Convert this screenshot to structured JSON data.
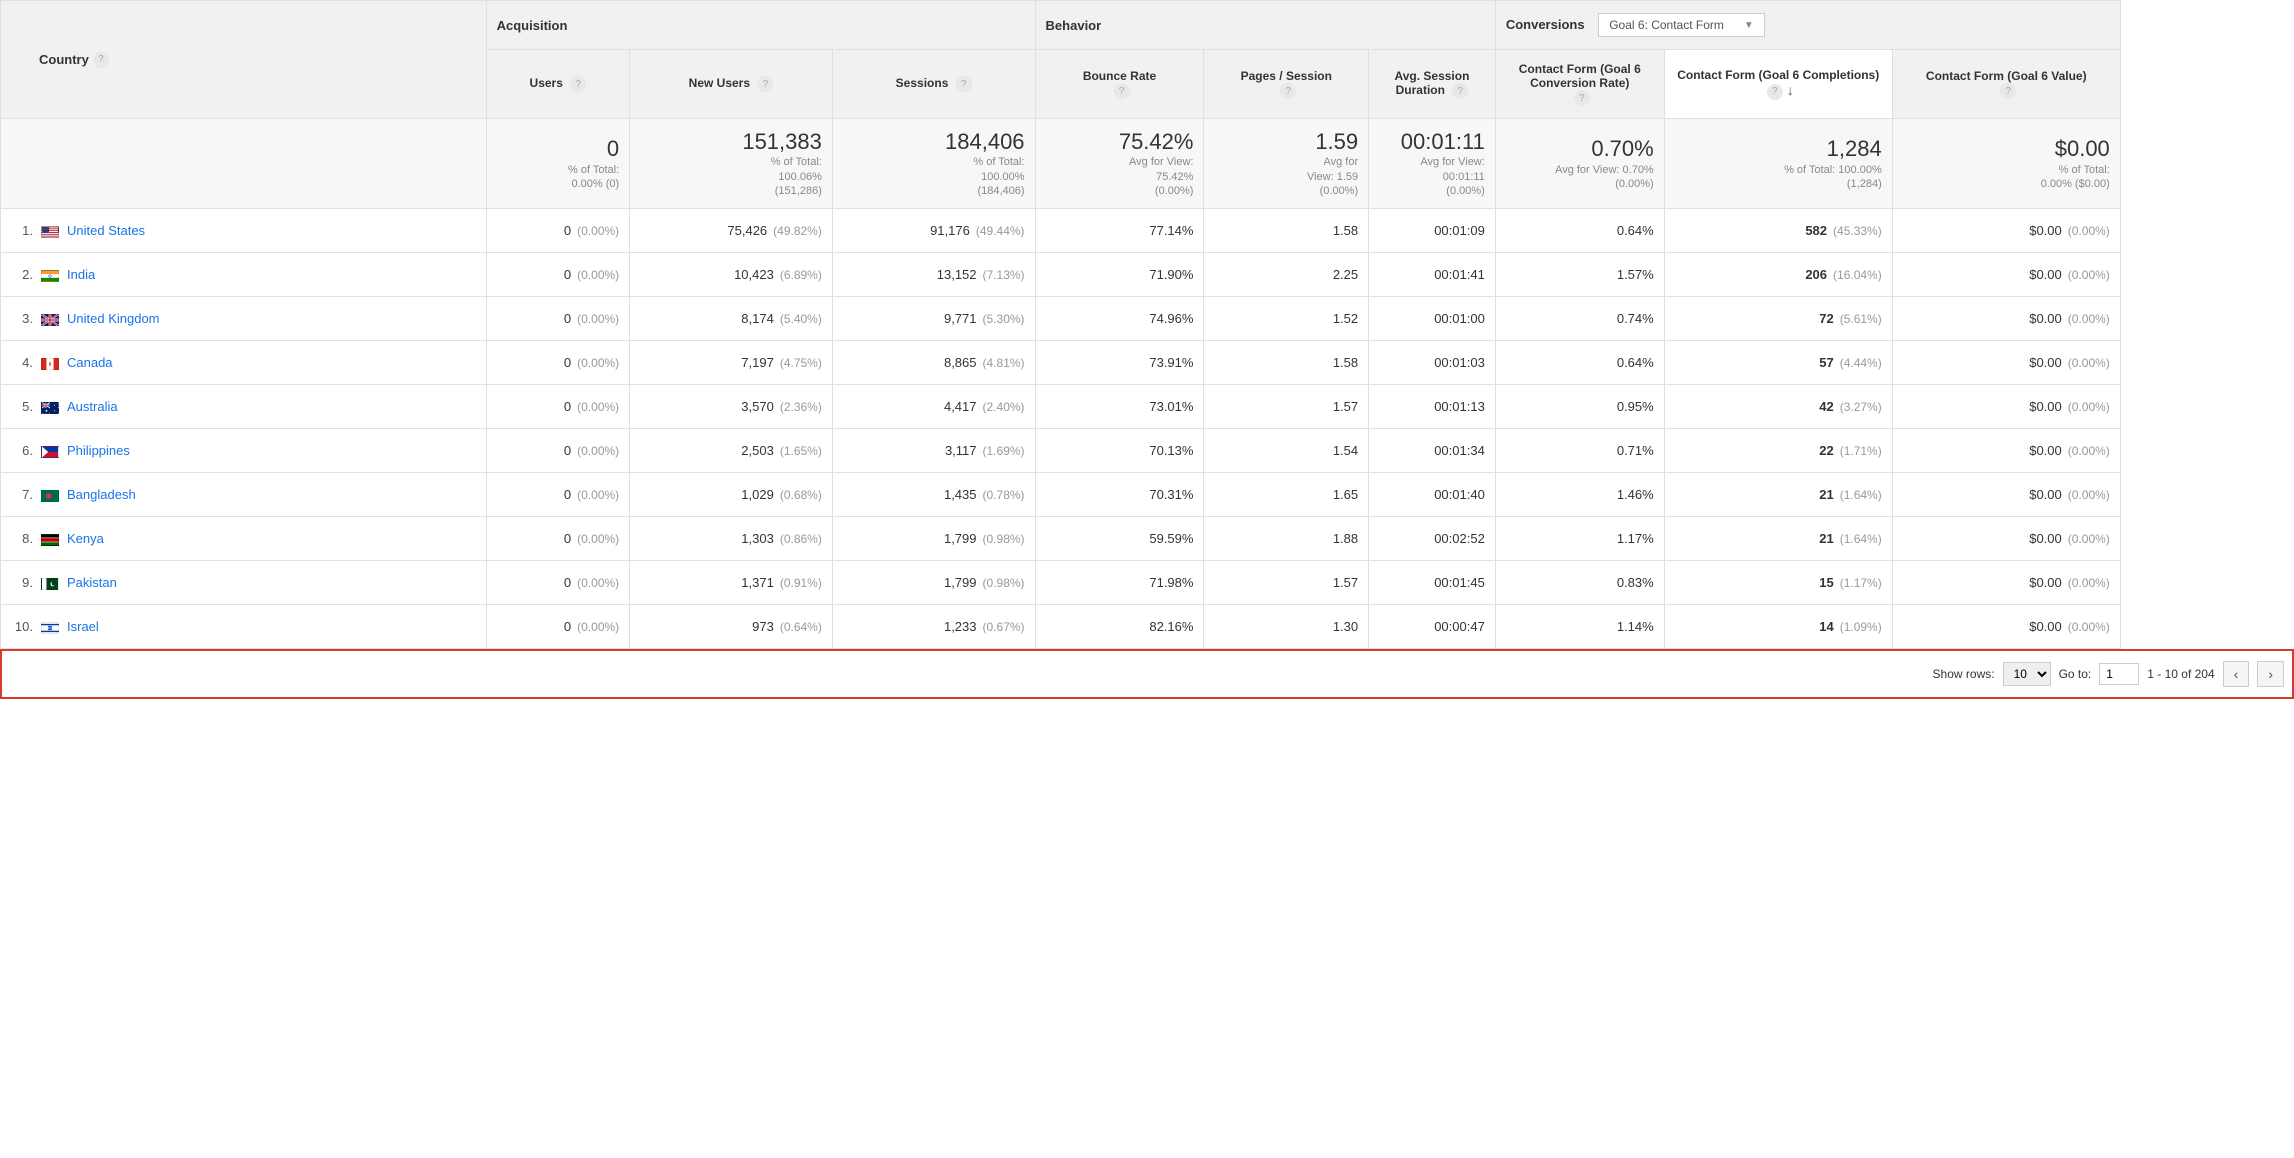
{
  "dimension_label": "Country",
  "groups": {
    "acquisition": "Acquisition",
    "behavior": "Behavior",
    "conversions": "Conversions"
  },
  "goal_selector": "Goal 6: Contact Form",
  "columns": {
    "users": "Users",
    "new_users": "New Users",
    "sessions": "Sessions",
    "bounce_rate": "Bounce Rate",
    "pages_session": "Pages / Session",
    "avg_duration": "Avg. Session Duration",
    "conv_rate": "Contact Form (Goal 6 Conversion Rate)",
    "completions": "Contact Form (Goal 6 Completions)",
    "value": "Contact Form (Goal 6 Value)"
  },
  "summary": {
    "users": {
      "big": "0",
      "sub1": "% of Total:",
      "sub2": "0.00% (0)"
    },
    "new_users": {
      "big": "151,383",
      "sub1": "% of Total:",
      "sub2": "100.06%",
      "sub3": "(151,286)"
    },
    "sessions": {
      "big": "184,406",
      "sub1": "% of Total:",
      "sub2": "100.00%",
      "sub3": "(184,406)"
    },
    "bounce_rate": {
      "big": "75.42%",
      "sub1": "Avg for View:",
      "sub2": "75.42%",
      "sub3": "(0.00%)"
    },
    "pages_session": {
      "big": "1.59",
      "sub1": "Avg for",
      "sub2": "View: 1.59",
      "sub3": "(0.00%)"
    },
    "avg_duration": {
      "big": "00:01:11",
      "sub1": "Avg for View:",
      "sub2": "00:01:11",
      "sub3": "(0.00%)"
    },
    "conv_rate": {
      "big": "0.70%",
      "sub1": "Avg for View: 0.70%",
      "sub2": "(0.00%)"
    },
    "completions": {
      "big": "1,284",
      "sub1": "% of Total: 100.00%",
      "sub2": "(1,284)"
    },
    "value": {
      "big": "$0.00",
      "sub1": "% of Total:",
      "sub2": "0.00% ($0.00)"
    }
  },
  "flags": {
    "United States": "data:image/svg+xml;utf8,<svg xmlns='http://www.w3.org/2000/svg' width='18' height='12'><rect width='18' height='12' fill='%23b22234'/><rect y='1' width='18' height='1' fill='white'/><rect y='3' width='18' height='1' fill='white'/><rect y='5' width='18' height='1' fill='white'/><rect y='7' width='18' height='1' fill='white'/><rect y='9' width='18' height='1' fill='white'/><rect y='11' width='18' height='1' fill='white'/><rect width='8' height='7' fill='%233c3b6e'/></svg>",
    "India": "data:image/svg+xml;utf8,<svg xmlns='http://www.w3.org/2000/svg' width='18' height='12'><rect width='18' height='4' fill='%23ff9933'/><rect y='4' width='18' height='4' fill='white'/><rect y='8' width='18' height='4' fill='%23138808'/><circle cx='9' cy='6' r='1.4' fill='none' stroke='%23000088' stroke-width='0.5'/></svg>",
    "United Kingdom": "data:image/svg+xml;utf8,<svg xmlns='http://www.w3.org/2000/svg' width='18' height='12'><rect width='18' height='12' fill='%23012169'/><path d='M0,0 L18,12 M18,0 L0,12' stroke='white' stroke-width='2'/><path d='M0,0 L18,12 M18,0 L0,12' stroke='%23C8102E' stroke-width='1'/><path d='M9,0 V12 M0,6 H18' stroke='white' stroke-width='3'/><path d='M9,0 V12 M0,6 H18' stroke='%23C8102E' stroke-width='1.5'/></svg>",
    "Canada": "data:image/svg+xml;utf8,<svg xmlns='http://www.w3.org/2000/svg' width='18' height='12'><rect width='18' height='12' fill='white'/><rect width='5' height='12' fill='%23d52b1e'/><rect x='13' width='5' height='12' fill='%23d52b1e'/><path d='M9 3 L10 6 L9 9 L8 6 Z' fill='%23d52b1e'/></svg>",
    "Australia": "data:image/svg+xml;utf8,<svg xmlns='http://www.w3.org/2000/svg' width='18' height='12'><rect width='18' height='12' fill='%23012169'/><rect width='9' height='6' fill='%23012169'/><path d='M0,0 L9,6 M9,0 L0,6' stroke='white' stroke-width='1'/><path d='M4.5,0 V6 M0,3 H9' stroke='white' stroke-width='1.5'/><path d='M4.5,0 V6 M0,3 H9' stroke='%23C8102E' stroke-width='0.8'/><circle cx='5' cy='9' r='1' fill='white'/><circle cx='14' cy='3' r='0.6' fill='white'/><circle cx='14' cy='9' r='0.6' fill='white'/></svg>",
    "Philippines": "data:image/svg+xml;utf8,<svg xmlns='http://www.w3.org/2000/svg' width='18' height='12'><rect width='18' height='6' fill='%230038a8'/><rect y='6' width='18' height='6' fill='%23ce1126'/><path d='M0,0 L7,6 L0,12 Z' fill='white'/></svg>",
    "Bangladesh": "data:image/svg+xml;utf8,<svg xmlns='http://www.w3.org/2000/svg' width='18' height='12'><rect width='18' height='12' fill='%23006a4e'/><circle cx='7.5' cy='6' r='3' fill='%23f42a41'/></svg>",
    "Kenya": "data:image/svg+xml;utf8,<svg xmlns='http://www.w3.org/2000/svg' width='18' height='12'><rect width='18' height='3.5' fill='black'/><rect y='3.5' width='18' height='0.5' fill='white'/><rect y='4' width='18' height='4' fill='%23bb0000'/><rect y='8' width='18' height='0.5' fill='white'/><rect y='8.5' width='18' height='3.5' fill='%23006600'/></svg>",
    "Pakistan": "data:image/svg+xml;utf8,<svg xmlns='http://www.w3.org/2000/svg' width='18' height='12'><rect width='18' height='12' fill='%2301411c'/><rect width='5' height='12' fill='white'/><circle cx='12' cy='6' r='2.5' fill='white'/><circle cx='13' cy='5.5' r='2.2' fill='%2301411c'/></svg>",
    "Israel": "data:image/svg+xml;utf8,<svg xmlns='http://www.w3.org/2000/svg' width='18' height='12'><rect width='18' height='12' fill='white'/><rect y='1.5' width='18' height='1.5' fill='%230038b8'/><rect y='9' width='18' height='1.5' fill='%230038b8'/><path d='M9 4 L11 8 L7 8 Z M9 8 L11 4 L7 4 Z' fill='none' stroke='%230038b8' stroke-width='0.7'/></svg>"
  },
  "rows": [
    {
      "rank": "1.",
      "country": "United States",
      "users": "0",
      "users_pct": "(0.00%)",
      "new_users": "75,426",
      "new_users_pct": "(49.82%)",
      "sessions": "91,176",
      "sessions_pct": "(49.44%)",
      "bounce": "77.14%",
      "pages": "1.58",
      "duration": "00:01:09",
      "conv_rate": "0.64%",
      "completions": "582",
      "completions_pct": "(45.33%)",
      "value": "$0.00",
      "value_pct": "(0.00%)"
    },
    {
      "rank": "2.",
      "country": "India",
      "users": "0",
      "users_pct": "(0.00%)",
      "new_users": "10,423",
      "new_users_pct": "(6.89%)",
      "sessions": "13,152",
      "sessions_pct": "(7.13%)",
      "bounce": "71.90%",
      "pages": "2.25",
      "duration": "00:01:41",
      "conv_rate": "1.57%",
      "completions": "206",
      "completions_pct": "(16.04%)",
      "value": "$0.00",
      "value_pct": "(0.00%)"
    },
    {
      "rank": "3.",
      "country": "United Kingdom",
      "users": "0",
      "users_pct": "(0.00%)",
      "new_users": "8,174",
      "new_users_pct": "(5.40%)",
      "sessions": "9,771",
      "sessions_pct": "(5.30%)",
      "bounce": "74.96%",
      "pages": "1.52",
      "duration": "00:01:00",
      "conv_rate": "0.74%",
      "completions": "72",
      "completions_pct": "(5.61%)",
      "value": "$0.00",
      "value_pct": "(0.00%)"
    },
    {
      "rank": "4.",
      "country": "Canada",
      "users": "0",
      "users_pct": "(0.00%)",
      "new_users": "7,197",
      "new_users_pct": "(4.75%)",
      "sessions": "8,865",
      "sessions_pct": "(4.81%)",
      "bounce": "73.91%",
      "pages": "1.58",
      "duration": "00:01:03",
      "conv_rate": "0.64%",
      "completions": "57",
      "completions_pct": "(4.44%)",
      "value": "$0.00",
      "value_pct": "(0.00%)"
    },
    {
      "rank": "5.",
      "country": "Australia",
      "users": "0",
      "users_pct": "(0.00%)",
      "new_users": "3,570",
      "new_users_pct": "(2.36%)",
      "sessions": "4,417",
      "sessions_pct": "(2.40%)",
      "bounce": "73.01%",
      "pages": "1.57",
      "duration": "00:01:13",
      "conv_rate": "0.95%",
      "completions": "42",
      "completions_pct": "(3.27%)",
      "value": "$0.00",
      "value_pct": "(0.00%)"
    },
    {
      "rank": "6.",
      "country": "Philippines",
      "users": "0",
      "users_pct": "(0.00%)",
      "new_users": "2,503",
      "new_users_pct": "(1.65%)",
      "sessions": "3,117",
      "sessions_pct": "(1.69%)",
      "bounce": "70.13%",
      "pages": "1.54",
      "duration": "00:01:34",
      "conv_rate": "0.71%",
      "completions": "22",
      "completions_pct": "(1.71%)",
      "value": "$0.00",
      "value_pct": "(0.00%)"
    },
    {
      "rank": "7.",
      "country": "Bangladesh",
      "users": "0",
      "users_pct": "(0.00%)",
      "new_users": "1,029",
      "new_users_pct": "(0.68%)",
      "sessions": "1,435",
      "sessions_pct": "(0.78%)",
      "bounce": "70.31%",
      "pages": "1.65",
      "duration": "00:01:40",
      "conv_rate": "1.46%",
      "completions": "21",
      "completions_pct": "(1.64%)",
      "value": "$0.00",
      "value_pct": "(0.00%)"
    },
    {
      "rank": "8.",
      "country": "Kenya",
      "users": "0",
      "users_pct": "(0.00%)",
      "new_users": "1,303",
      "new_users_pct": "(0.86%)",
      "sessions": "1,799",
      "sessions_pct": "(0.98%)",
      "bounce": "59.59%",
      "pages": "1.88",
      "duration": "00:02:52",
      "conv_rate": "1.17%",
      "completions": "21",
      "completions_pct": "(1.64%)",
      "value": "$0.00",
      "value_pct": "(0.00%)"
    },
    {
      "rank": "9.",
      "country": "Pakistan",
      "users": "0",
      "users_pct": "(0.00%)",
      "new_users": "1,371",
      "new_users_pct": "(0.91%)",
      "sessions": "1,799",
      "sessions_pct": "(0.98%)",
      "bounce": "71.98%",
      "pages": "1.57",
      "duration": "00:01:45",
      "conv_rate": "0.83%",
      "completions": "15",
      "completions_pct": "(1.17%)",
      "value": "$0.00",
      "value_pct": "(0.00%)"
    },
    {
      "rank": "10.",
      "country": "Israel",
      "users": "0",
      "users_pct": "(0.00%)",
      "new_users": "973",
      "new_users_pct": "(0.64%)",
      "sessions": "1,233",
      "sessions_pct": "(0.67%)",
      "bounce": "82.16%",
      "pages": "1.30",
      "duration": "00:00:47",
      "conv_rate": "1.14%",
      "completions": "14",
      "completions_pct": "(1.09%)",
      "value": "$0.00",
      "value_pct": "(0.00%)"
    }
  ],
  "footer": {
    "show_rows_label": "Show rows:",
    "show_rows_value": "10",
    "goto_label": "Go to:",
    "goto_value": "1",
    "range": "1 - 10 of 204"
  }
}
